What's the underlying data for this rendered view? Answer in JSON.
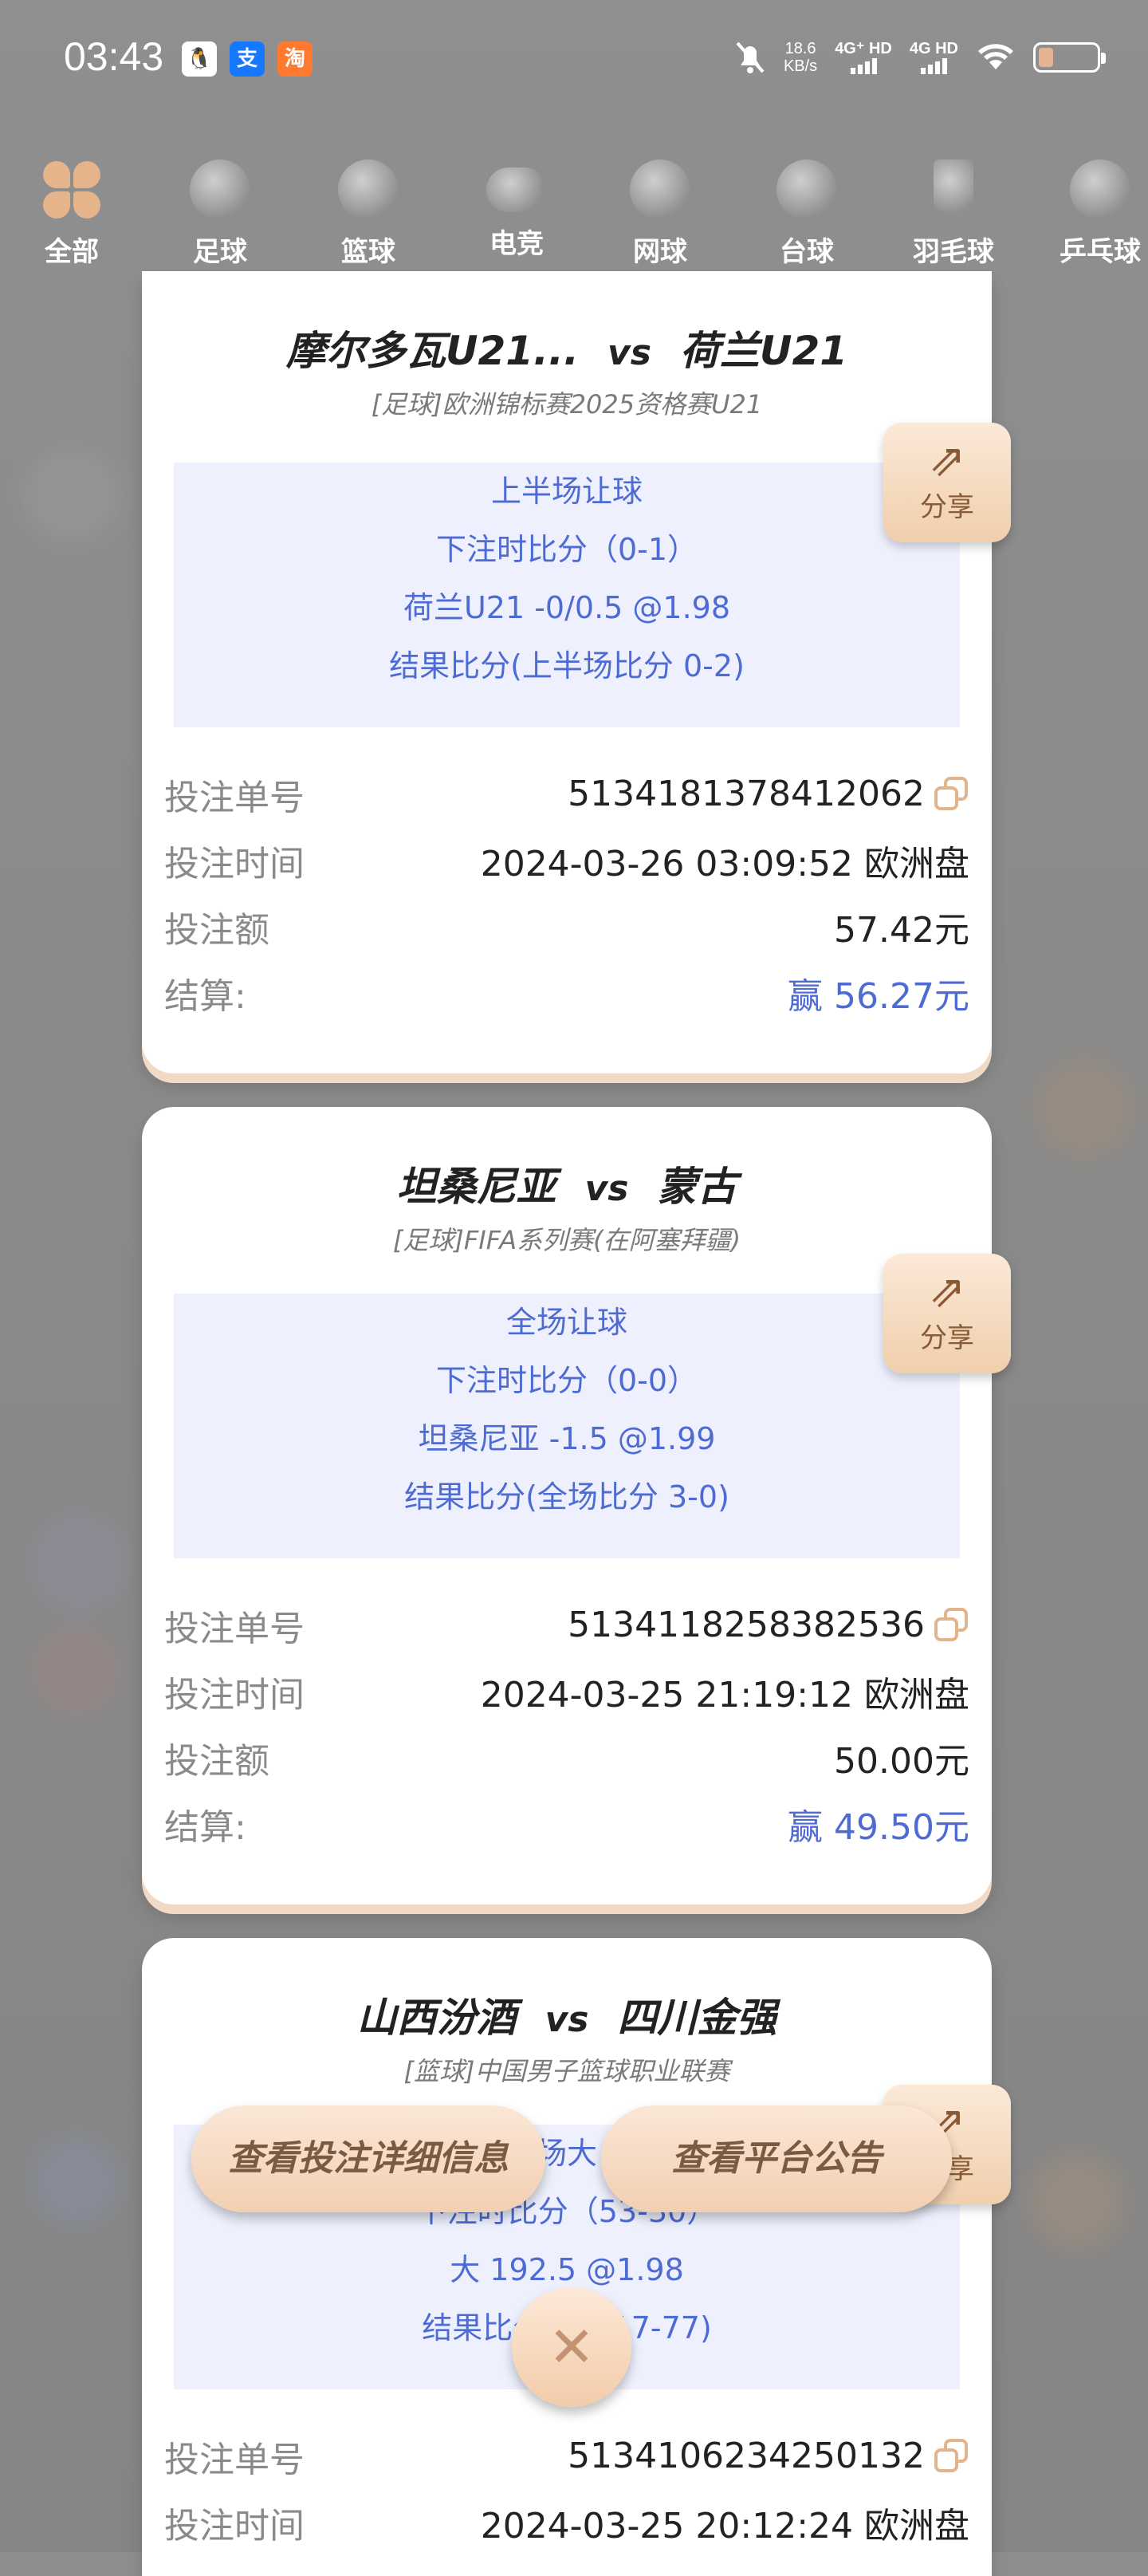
{
  "status": {
    "time": "03:43",
    "apps": [
      "qq-icon",
      "alipay-icon",
      "taobao-icon"
    ],
    "net_speed_value": "18.6",
    "net_speed_unit": "KB/s",
    "sim1": "4G⁺ HD",
    "sim2": "4G HD"
  },
  "categories": [
    {
      "label": "全部",
      "icon": "clover-icon",
      "active": true
    },
    {
      "label": "足球",
      "icon": "football-icon"
    },
    {
      "label": "篮球",
      "icon": "basketball-icon"
    },
    {
      "label": "电竞",
      "icon": "gamepad-icon"
    },
    {
      "label": "网球",
      "icon": "tennis-icon"
    },
    {
      "label": "台球",
      "icon": "billiards-icon"
    },
    {
      "label": "羽毛球",
      "icon": "badminton-icon"
    },
    {
      "label": "乒乓球",
      "icon": "pingpong-icon"
    }
  ],
  "labels": {
    "order_no": "投注单号",
    "bet_time": "投注时间",
    "amount": "投注额",
    "settle": "结算:",
    "share": "分享"
  },
  "bets": [
    {
      "home": "摩尔多瓦U21...",
      "vs": "vs",
      "away": "荷兰U21",
      "league": "[足球]欧洲锦标赛2025资格赛U21",
      "bet_type": "上半场让球",
      "score_at_bet": "下注时比分（0-1）",
      "pick": "荷兰U21  -0/0.5   @1.98",
      "result": "结果比分(上半场比分 0-2)",
      "order_no": "5134181378412062",
      "time": "2024-03-26 03:09:52 欧洲盘",
      "amount": "57.42元",
      "settle": "赢 56.27元"
    },
    {
      "home": "坦桑尼亚",
      "vs": "vs",
      "away": "蒙古",
      "league": "[足球]FIFA系列赛(在阿塞拜疆)",
      "bet_type": "全场让球",
      "score_at_bet": "下注时比分（0-0）",
      "pick": "坦桑尼亚  -1.5   @1.99",
      "result": "结果比分(全场比分 3-0)",
      "order_no": "5134118258382536",
      "time": "2024-03-25 21:19:12 欧洲盘",
      "amount": "50.00元",
      "settle": "赢 49.50元"
    },
    {
      "home": "山西汾酒",
      "vs": "vs",
      "away": "四川金强",
      "league": "[篮球]中国男子篮球职业联赛",
      "bet_type": "场大",
      "score_at_bet": "下注时比分（53-30）",
      "pick": "大 192.5   @1.98",
      "result": "结果比分      分 117-77)",
      "order_no": "5134106234250132",
      "time": "2024-03-25 20:12:24 欧洲盘"
    }
  ],
  "actions": {
    "detail": "查看投注详细信息",
    "notice": "查看平台公告",
    "close": "✕"
  }
}
